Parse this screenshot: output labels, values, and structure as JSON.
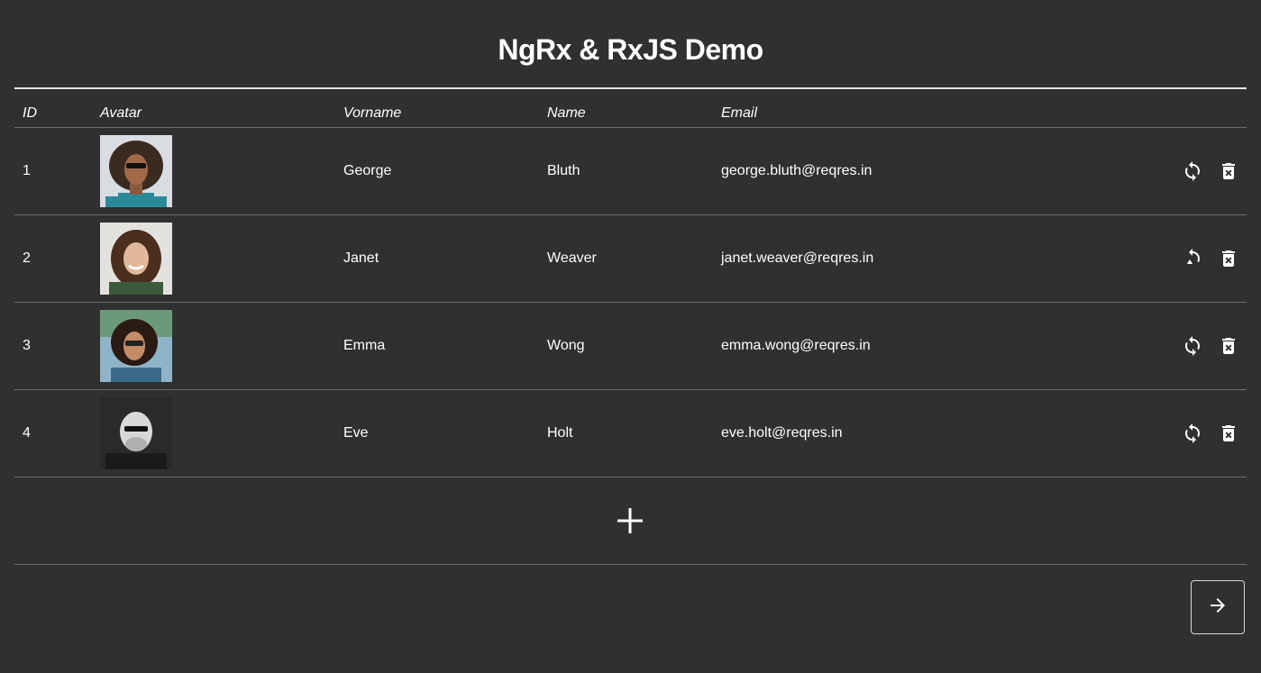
{
  "header": {
    "title": "NgRx & RxJS Demo"
  },
  "table": {
    "columns": {
      "id": "ID",
      "avatar": "Avatar",
      "first_name": "Vorname",
      "last_name": "Name",
      "email": "Email"
    },
    "rows": [
      {
        "id": "1",
        "first_name": "George",
        "last_name": "Bluth",
        "email": "george.bluth@reqres.in"
      },
      {
        "id": "2",
        "first_name": "Janet",
        "last_name": "Weaver",
        "email": "janet.weaver@reqres.in"
      },
      {
        "id": "3",
        "first_name": "Emma",
        "last_name": "Wong",
        "email": "emma.wong@reqres.in"
      },
      {
        "id": "4",
        "first_name": "Eve",
        "last_name": "Holt",
        "email": "eve.holt@reqres.in"
      }
    ],
    "row_actions": [
      "refresh-icon",
      "delete-icon"
    ]
  },
  "add_action": {
    "icon": "plus-icon"
  },
  "pagination": {
    "next_icon": "arrow-right-icon"
  },
  "colors": {
    "background": "#303030",
    "text": "#ffffff",
    "divider": "#6e6e6e"
  }
}
